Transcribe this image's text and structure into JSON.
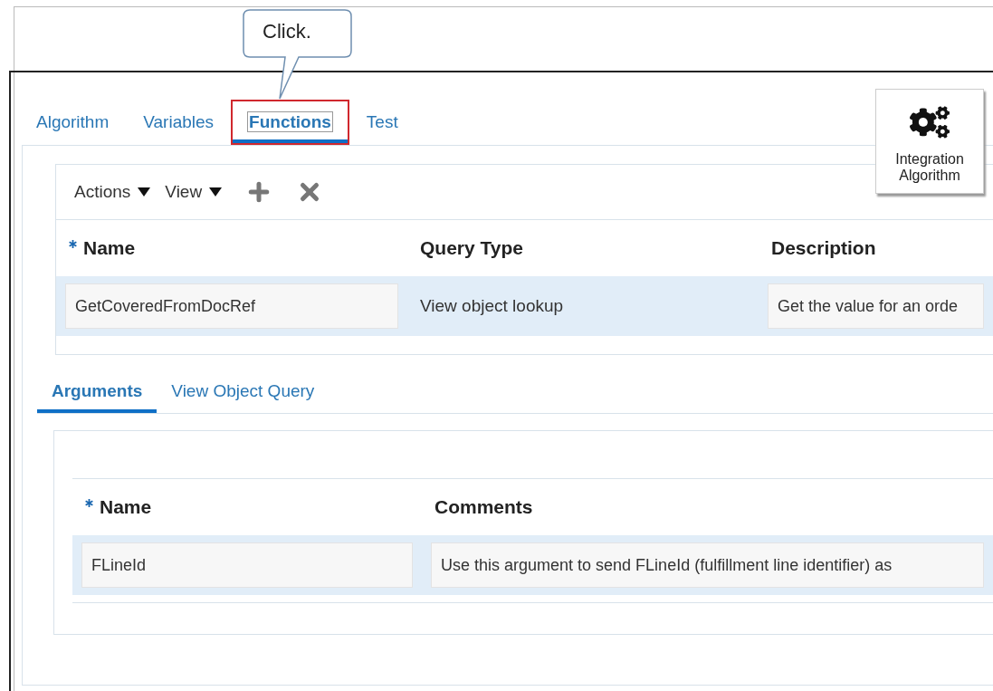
{
  "callout": {
    "text": "Click."
  },
  "tabs": [
    {
      "label": "Algorithm",
      "selected": false,
      "highlighted": false
    },
    {
      "label": "Variables",
      "selected": false,
      "highlighted": false
    },
    {
      "label": "Functions",
      "selected": true,
      "highlighted": true
    },
    {
      "label": "Test",
      "selected": false,
      "highlighted": false
    }
  ],
  "integration_button": {
    "label": "Integration Algorithm"
  },
  "toolbar": {
    "menus": [
      "Actions",
      "View"
    ]
  },
  "functions_table": {
    "columns": [
      {
        "label": "Name",
        "required": true
      },
      {
        "label": "Query Type",
        "required": false
      },
      {
        "label": "Description",
        "required": false
      }
    ],
    "rows": [
      {
        "selected": true,
        "cells": [
          {
            "kind": "field",
            "text": "GetCoveredFromDocRef"
          },
          {
            "kind": "text",
            "text": "View object lookup"
          },
          {
            "kind": "field",
            "text": "Get the value for an orde"
          }
        ]
      }
    ]
  },
  "sub_tabs": [
    {
      "label": "Arguments",
      "selected": true
    },
    {
      "label": "View Object Query",
      "selected": false
    }
  ],
  "arguments_table": {
    "columns": [
      {
        "label": "Name",
        "required": true
      },
      {
        "label": "Comments",
        "required": false
      }
    ],
    "rows": [
      {
        "selected": true,
        "cells": [
          {
            "kind": "field",
            "text": "FLineId"
          },
          {
            "kind": "field",
            "text": "Use this argument to send FLineId (fulfillment line identifier) as"
          }
        ]
      }
    ]
  }
}
